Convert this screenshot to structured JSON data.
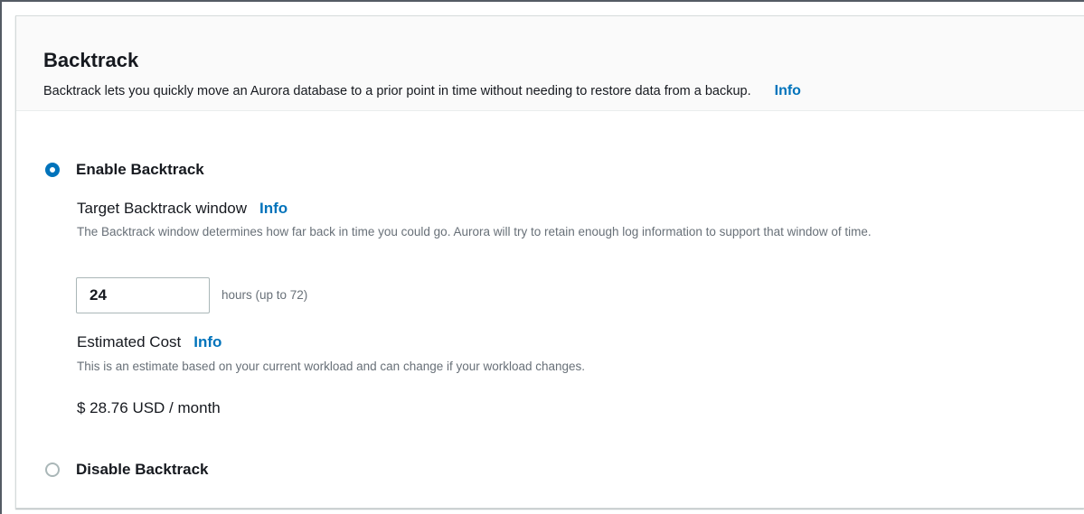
{
  "panel": {
    "title": "Backtrack",
    "description": "Backtrack lets you quickly move an Aurora database to a prior point in time without needing to restore data from a backup.",
    "info_label": "Info"
  },
  "options": {
    "enable": {
      "label": "Enable Backtrack",
      "selected": true
    },
    "disable": {
      "label": "Disable Backtrack",
      "selected": false
    }
  },
  "target_window": {
    "label": "Target Backtrack window",
    "info_label": "Info",
    "description": "The Backtrack window determines how far back in time you could go. Aurora will try to retain enough log information to support that window of time.",
    "value": "24",
    "suffix": "hours (up to 72)"
  },
  "estimated_cost": {
    "label": "Estimated Cost",
    "info_label": "Info",
    "description": "This is an estimate based on your current workload and can change if your workload changes.",
    "value": "$ 28.76 USD / month"
  },
  "colors": {
    "link": "#0073bb",
    "radio_selected": "#0073bb",
    "header_bg": "#fafafa",
    "muted_text": "#687078"
  }
}
